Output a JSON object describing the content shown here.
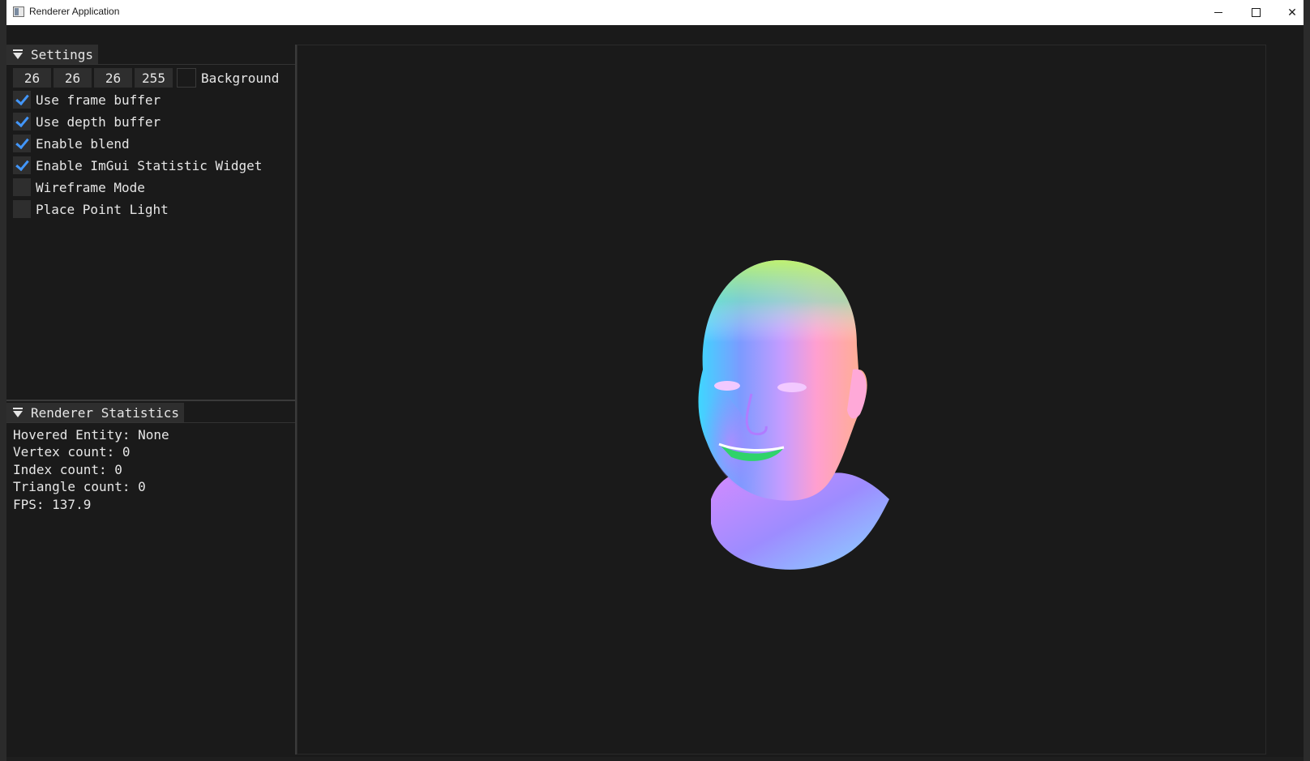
{
  "window": {
    "title": "Renderer Application"
  },
  "settings": {
    "header": "Settings",
    "background": {
      "r": "26",
      "g": "26",
      "b": "26",
      "a": "255",
      "label": "Background",
      "color": "#1a1a1a"
    },
    "options": [
      {
        "label": "Use frame buffer",
        "checked": true
      },
      {
        "label": "Use depth buffer",
        "checked": true
      },
      {
        "label": "Enable blend",
        "checked": true
      },
      {
        "label": "Enable ImGui Statistic Widget",
        "checked": true
      },
      {
        "label": "Wireframe Mode",
        "checked": false
      },
      {
        "label": "Place Point Light",
        "checked": false
      }
    ]
  },
  "stats": {
    "header": "Renderer Statistics",
    "lines": [
      "Hovered Entity: None",
      "Vertex count: 0",
      "Index count: 0",
      "Triangle count: 0",
      "FPS: 137.9"
    ]
  },
  "colors": {
    "accent_check": "#4296fa",
    "panel_bg": "#1a1a1a",
    "widget_bg": "#2e2e2e"
  },
  "icons": {
    "window_icon": "app-window-icon",
    "collapse": "triangle-down-icon",
    "check": "checkmark-icon"
  }
}
